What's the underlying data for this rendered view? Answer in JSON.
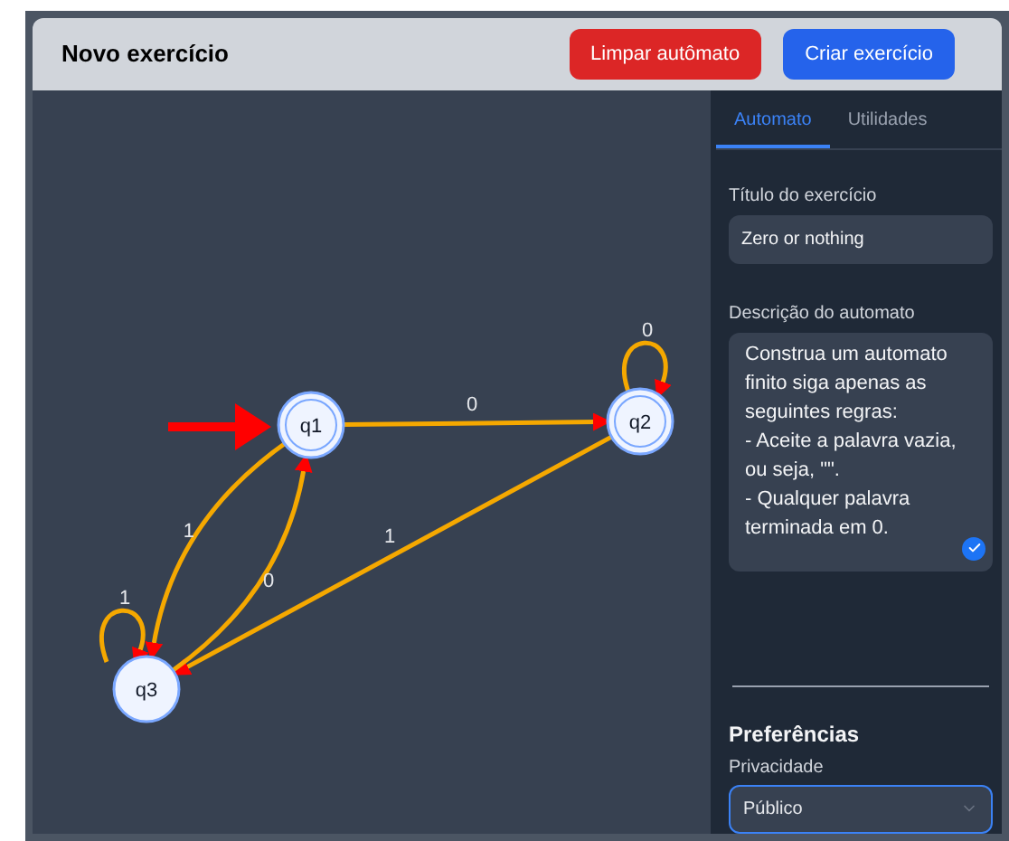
{
  "header": {
    "title": "Novo exercício",
    "buttons": [
      {
        "label": "Limpar autômato",
        "kind": "danger"
      },
      {
        "label": "Criar exercício",
        "kind": "primary"
      }
    ]
  },
  "automaton": {
    "states": [
      {
        "name": "q1",
        "accepting": true,
        "initial": true
      },
      {
        "name": "q2",
        "accepting": true,
        "initial": false
      },
      {
        "name": "q3",
        "accepting": false,
        "initial": false
      }
    ],
    "transitions": [
      {
        "kind": "loop",
        "symbol": "0"
      },
      {
        "kind": "line",
        "symbol": "0"
      },
      {
        "kind": "curve",
        "symbol": "1"
      },
      {
        "kind": "line",
        "symbol": "1"
      },
      {
        "kind": "curve",
        "symbol": "0"
      },
      {
        "kind": "loop",
        "symbol": "1"
      }
    ]
  },
  "tabs": [
    {
      "label": "Automato",
      "selected": true
    },
    {
      "label": "Utilidades",
      "selected": false
    }
  ],
  "form": {
    "title_label": "Título do exercício",
    "title_value": "Zero or nothing",
    "description_label": "Descrição do automato",
    "description_value": "Construa um automato finito siga apenas as seguintes regras:\n- Aceite a palavra vazia, ou seja, \"\".\n- Qualquer palavra terminada em 0."
  },
  "preferences": {
    "heading": "Preferências",
    "privacy_label": "Privacidade",
    "privacy_value": "Público"
  }
}
